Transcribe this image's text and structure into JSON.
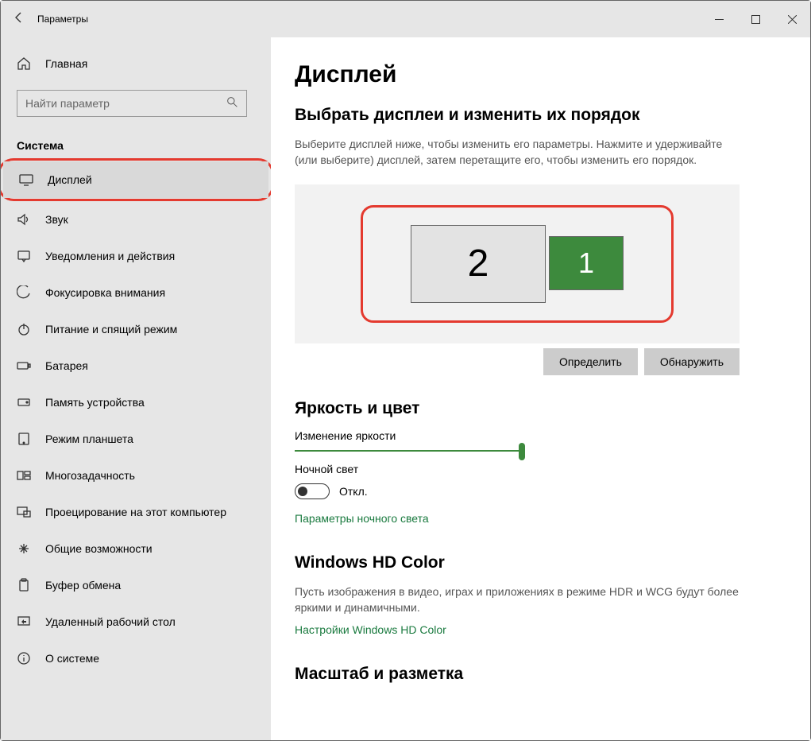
{
  "window": {
    "title": "Параметры"
  },
  "sidebar": {
    "home": "Главная",
    "search_placeholder": "Найти параметр",
    "category": "Система",
    "items": [
      {
        "id": "display",
        "label": "Дисплей"
      },
      {
        "id": "sound",
        "label": "Звук"
      },
      {
        "id": "notif",
        "label": "Уведомления и действия"
      },
      {
        "id": "focus",
        "label": "Фокусировка внимания"
      },
      {
        "id": "power",
        "label": "Питание и спящий режим"
      },
      {
        "id": "battery",
        "label": "Батарея"
      },
      {
        "id": "storage",
        "label": "Память устройства"
      },
      {
        "id": "tablet",
        "label": "Режим планшета"
      },
      {
        "id": "multitask",
        "label": "Многозадачность"
      },
      {
        "id": "project",
        "label": "Проецирование на этот компьютер"
      },
      {
        "id": "shared",
        "label": "Общие возможности"
      },
      {
        "id": "clipboard",
        "label": "Буфер обмена"
      },
      {
        "id": "remote",
        "label": "Удаленный рабочий стол"
      },
      {
        "id": "about",
        "label": "О системе"
      }
    ]
  },
  "main": {
    "title": "Дисплей",
    "arrange": {
      "heading": "Выбрать дисплеи и изменить их порядок",
      "description": "Выберите дисплей ниже, чтобы изменить его параметры. Нажмите и удерживайте (или выберите) дисплей, затем перетащите его, чтобы изменить его порядок.",
      "monitor2": "2",
      "monitor1": "1",
      "identify": "Определить",
      "detect": "Обнаружить"
    },
    "brightness": {
      "heading": "Яркость и цвет",
      "slider_label": "Изменение яркости",
      "night_label": "Ночной свет",
      "night_state": "Откл.",
      "night_link": "Параметры ночного света"
    },
    "hdcolor": {
      "heading": "Windows HD Color",
      "description": "Пусть изображения в видео, играх и приложениях в режиме HDR и WCG будут более яркими и динамичными.",
      "link": "Настройки Windows HD Color"
    },
    "scale": {
      "heading": "Масштаб и разметка"
    }
  }
}
